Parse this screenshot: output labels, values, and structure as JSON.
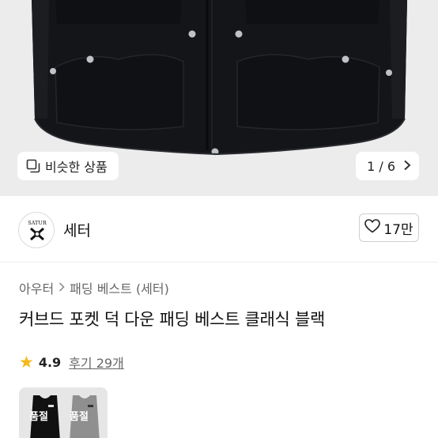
{
  "hero": {
    "similar_label": "비슷한 상품",
    "similar_icon": "copy-icon",
    "counter": "1 / 6",
    "next_icon": "chevron-right-icon"
  },
  "shop": {
    "logo_text": "SATUR",
    "name": "세터",
    "likes": "17만",
    "like_icon": "heart-icon"
  },
  "breadcrumb": {
    "items": [
      "아우터",
      "패딩 베스트 (세터)"
    ]
  },
  "product": {
    "title": "커브드 포켓 덕 다운 패딩 베스트 클래식 블랙",
    "rating": "4.9",
    "reviews": "후기 29개",
    "rating_icon": "star-icon"
  },
  "options": [
    {
      "label": "품절",
      "color": "#111111"
    },
    {
      "label": "품절",
      "color": "#8f8f8f"
    }
  ],
  "colors": {
    "star": "#f5b818",
    "hero_bg": "#ececec"
  }
}
